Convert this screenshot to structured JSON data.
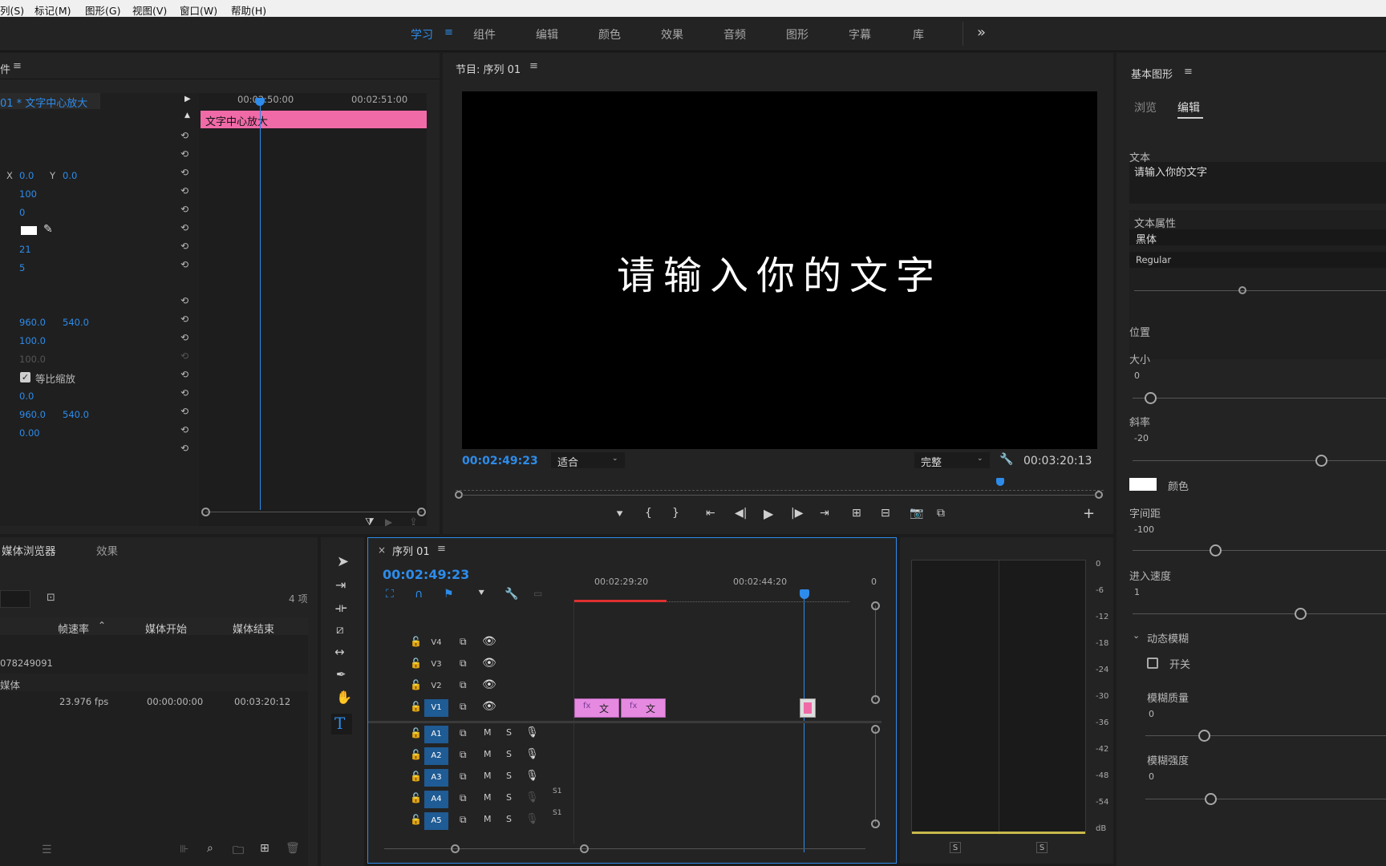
{
  "menu": [
    "列(S)",
    "标记(M)",
    "图形(G)",
    "视图(V)",
    "窗口(W)",
    "帮助(H)"
  ],
  "workspaces": [
    "学习",
    "组件",
    "编辑",
    "颜色",
    "效果",
    "音频",
    "图形",
    "字幕",
    "库"
  ],
  "more_icon": "»",
  "effect_controls": {
    "title": "件",
    "clip_label": "01 * 文字中心放大",
    "time_a": "00:02:50:00",
    "time_b": "00:02:51:00",
    "clip_name": "文字中心放大",
    "x_label": "X",
    "x_val": "0.0",
    "y_label": "Y",
    "y_val": "0.0",
    "v100": "100",
    "v0": "0",
    "v21": "21",
    "v5": "5",
    "pos_x": "960.0",
    "pos_y": "540.0",
    "scale": "100.0",
    "scale_w": "100.0",
    "uniform_label": "等比缩放",
    "rot": "0.0",
    "anchor_x": "960.0",
    "anchor_y": "540.0",
    "flicker": "0.00"
  },
  "program": {
    "title": "节目: 序列 01",
    "overlay_text": "请输入你的文字",
    "timecode": "00:02:49:23",
    "fit": "适合",
    "quality": "完整",
    "duration": "00:03:20:13"
  },
  "project": {
    "tab_media": "媒体浏览器",
    "tab_effects": "效果",
    "items_count": "4 项",
    "col_fps": "帧速率",
    "col_start": "媒体开始",
    "col_end": "媒体结束",
    "row1": "078249091",
    "row2": "媒体",
    "row3_fps": "23.976 fps",
    "row3_start": "00:00:00:00",
    "row3_end": "00:03:20:12"
  },
  "timeline": {
    "title": "序列 01",
    "timecode": "00:02:49:23",
    "ruler": [
      "00:02:29:20",
      "00:02:44:20",
      "0"
    ],
    "video_tracks": [
      "V4",
      "V3",
      "V2",
      "V1"
    ],
    "audio_tracks": [
      "A1",
      "A2",
      "A3",
      "A4",
      "A5"
    ],
    "m": "M",
    "s": "S",
    "s1": "S1",
    "clip_text": "文"
  },
  "meter": {
    "scale": [
      "0",
      "-6",
      "-12",
      "-18",
      "-24",
      "-30",
      "-36",
      "-42",
      "-48",
      "-54",
      "dB"
    ],
    "solo_l": "S",
    "solo_r": "S"
  },
  "essential_graphics": {
    "title": "基本图形",
    "tab_browse": "浏览",
    "tab_edit": "编辑",
    "text_label": "文本",
    "text_value": "请输入你的文字",
    "text_props": "文本属性",
    "font": "黑体",
    "style": "Regular",
    "position_label": "位置",
    "size_label": "大小",
    "size_val": "0",
    "slope_label": "斜率",
    "slope_val": "-20",
    "color_label": "颜色",
    "spacing_label": "字间距",
    "spacing_val": "-100",
    "speed_label": "进入速度",
    "speed_val": "1",
    "blur_label": "动态模糊",
    "switch_label": "开关",
    "blur_quality_label": "模糊质量",
    "blur_quality_val": "0",
    "blur_strength_label": "模糊强度",
    "blur_strength_val": "0"
  },
  "colors": {
    "accent": "#2d8ceb",
    "clip_pink": "#f06aa8",
    "clip_magenta": "#e58ae0",
    "track_blue": "#1f5b94"
  }
}
